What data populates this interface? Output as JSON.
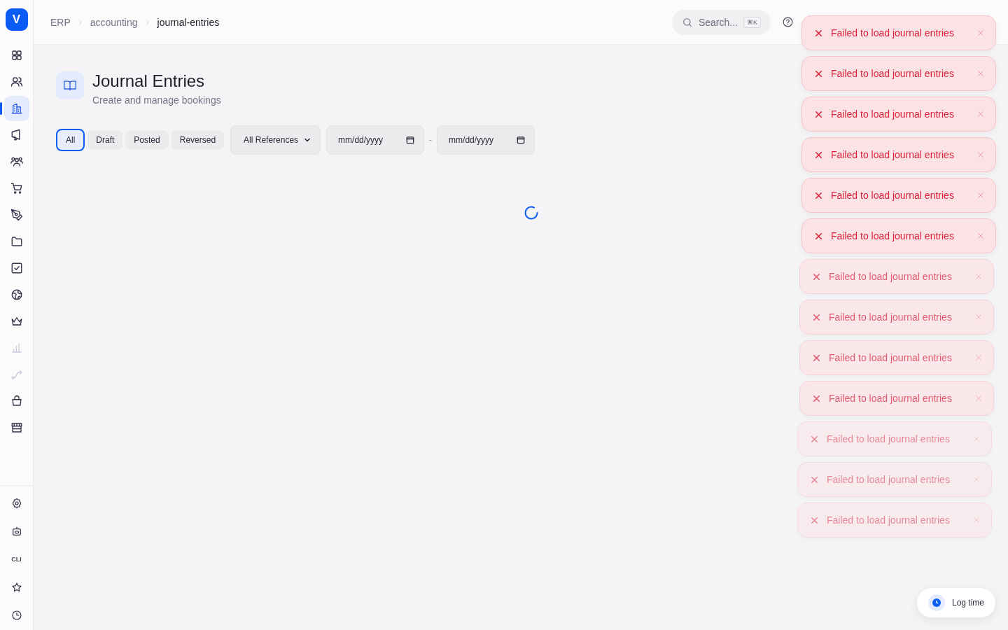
{
  "sidebar": {
    "logo": "V",
    "items": [
      {
        "selected": false,
        "disabled": false
      },
      {
        "selected": false,
        "disabled": false
      },
      {
        "selected": true,
        "disabled": false
      },
      {
        "selected": false,
        "disabled": false
      },
      {
        "selected": false,
        "disabled": false
      },
      {
        "selected": false,
        "disabled": false
      },
      {
        "selected": false,
        "disabled": false
      },
      {
        "selected": false,
        "disabled": false
      },
      {
        "selected": false,
        "disabled": false
      },
      {
        "selected": false,
        "disabled": false
      },
      {
        "selected": false,
        "disabled": false
      },
      {
        "selected": false,
        "disabled": true
      },
      {
        "selected": false,
        "disabled": true
      },
      {
        "selected": false,
        "disabled": false
      },
      {
        "selected": false,
        "disabled": false
      }
    ],
    "bottom_items": [
      {
        "kind": "icon"
      },
      {
        "kind": "icon"
      },
      {
        "kind": "text",
        "label": "CLI"
      },
      {
        "kind": "icon"
      },
      {
        "kind": "icon"
      }
    ]
  },
  "header": {
    "breadcrumbs": [
      {
        "label": "ERP",
        "current": false
      },
      {
        "label": "accounting",
        "current": false
      },
      {
        "label": "journal-entries",
        "current": true
      }
    ],
    "search": {
      "placeholder": "Search...",
      "shortcut": "⌘K"
    }
  },
  "page": {
    "title": "Journal Entries",
    "subtitle": "Create and manage bookings",
    "filters": [
      {
        "label": "All",
        "selected": true
      },
      {
        "label": "Draft",
        "selected": false
      },
      {
        "label": "Posted",
        "selected": false
      },
      {
        "label": "Reversed",
        "selected": false
      }
    ],
    "reference_select": {
      "value": "All References"
    },
    "date_from": {
      "placeholder": "mm/dd/yyyy"
    },
    "date_separator": "-",
    "date_to": {
      "placeholder": "mm/dd/yyyy"
    },
    "loading": true
  },
  "toasts": [
    {
      "message": "Failed to load journal entries",
      "fading": false,
      "faint": false
    },
    {
      "message": "Failed to load journal entries",
      "fading": false,
      "faint": false
    },
    {
      "message": "Failed to load journal entries",
      "fading": false,
      "faint": false
    },
    {
      "message": "Failed to load journal entries",
      "fading": false,
      "faint": false
    },
    {
      "message": "Failed to load journal entries",
      "fading": false,
      "faint": false
    },
    {
      "message": "Failed to load journal entries",
      "fading": false,
      "faint": false
    },
    {
      "message": "Failed to load journal entries",
      "fading": true,
      "faint": false
    },
    {
      "message": "Failed to load journal entries",
      "fading": true,
      "faint": false
    },
    {
      "message": "Failed to load journal entries",
      "fading": true,
      "faint": false
    },
    {
      "message": "Failed to load journal entries",
      "fading": true,
      "faint": false
    },
    {
      "message": "Failed to load journal entries",
      "fading": true,
      "faint": true
    },
    {
      "message": "Failed to load journal entries",
      "fading": true,
      "faint": true
    },
    {
      "message": "Failed to load journal entries",
      "fading": true,
      "faint": true
    }
  ],
  "log_time_button": {
    "label": "Log time"
  }
}
